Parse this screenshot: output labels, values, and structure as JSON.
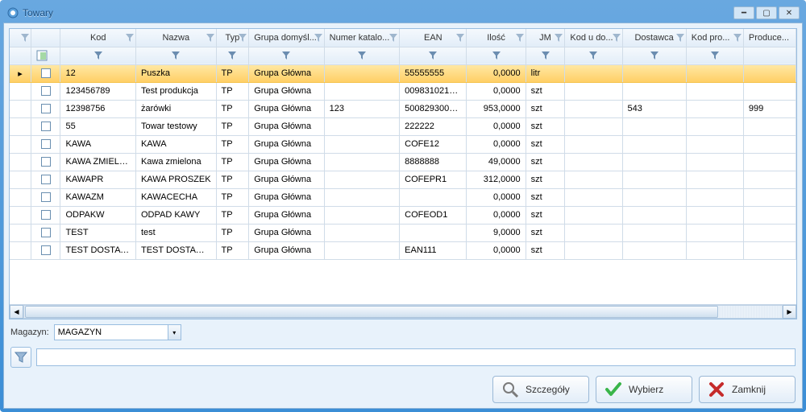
{
  "window": {
    "title": "Towary"
  },
  "columns": {
    "kod": "Kod",
    "nazwa": "Nazwa",
    "typ": "Typ",
    "grupa": "Grupa domyśl...",
    "nkat": "Numer katalo...",
    "ean": "EAN",
    "ilosc": "Ilość",
    "jm": "JM",
    "kodd": "Kod u do...",
    "dost": "Dostawca",
    "kodp": "Kod pro...",
    "prod": "Produce..."
  },
  "rows": [
    {
      "kod": "12",
      "nazwa": "Puszka",
      "typ": "TP",
      "grupa": "Grupa Główna",
      "nkat": "",
      "ean": "55555555",
      "ilosc": "0,0000",
      "jm": "litr",
      "kodd": "",
      "dost": "",
      "kodp": "",
      "prod": ""
    },
    {
      "kod": "123456789",
      "nazwa": "Test produkcja",
      "typ": "TP",
      "grupa": "Grupa Główna",
      "nkat": "",
      "ean": "0098310213...",
      "ilosc": "0,0000",
      "jm": "szt",
      "kodd": "",
      "dost": "",
      "kodp": "",
      "prod": ""
    },
    {
      "kod": "12398756",
      "nazwa": "żarówki",
      "typ": "TP",
      "grupa": "Grupa Główna",
      "nkat": "123",
      "ean": "5008293001...",
      "ilosc": "953,0000",
      "jm": "szt",
      "kodd": "",
      "dost": "543",
      "kodp": "",
      "prod": "999"
    },
    {
      "kod": "55",
      "nazwa": "Towar testowy",
      "typ": "TP",
      "grupa": "Grupa Główna",
      "nkat": "",
      "ean": "222222",
      "ilosc": "0,0000",
      "jm": "szt",
      "kodd": "",
      "dost": "",
      "kodp": "",
      "prod": ""
    },
    {
      "kod": "KAWA",
      "nazwa": "KAWA",
      "typ": "TP",
      "grupa": "Grupa Główna",
      "nkat": "",
      "ean": "COFE12",
      "ilosc": "0,0000",
      "jm": "szt",
      "kodd": "",
      "dost": "",
      "kodp": "",
      "prod": ""
    },
    {
      "kod": "KAWA  ZMIELO...",
      "nazwa": "Kawa zmielona",
      "typ": "TP",
      "grupa": "Grupa Główna",
      "nkat": "",
      "ean": "8888888",
      "ilosc": "49,0000",
      "jm": "szt",
      "kodd": "",
      "dost": "",
      "kodp": "",
      "prod": ""
    },
    {
      "kod": "KAWAPR",
      "nazwa": "KAWA PROSZEK",
      "typ": "TP",
      "grupa": "Grupa Główna",
      "nkat": "",
      "ean": "COFEPR1",
      "ilosc": "312,0000",
      "jm": "szt",
      "kodd": "",
      "dost": "",
      "kodp": "",
      "prod": ""
    },
    {
      "kod": "KAWAZM",
      "nazwa": "KAWACECHA",
      "typ": "TP",
      "grupa": "Grupa Główna",
      "nkat": "",
      "ean": "",
      "ilosc": "0,0000",
      "jm": "szt",
      "kodd": "",
      "dost": "",
      "kodp": "",
      "prod": ""
    },
    {
      "kod": "ODPAKW",
      "nazwa": "ODPAD KAWY",
      "typ": "TP",
      "grupa": "Grupa Główna",
      "nkat": "",
      "ean": "COFEOD1",
      "ilosc": "0,0000",
      "jm": "szt",
      "kodd": "",
      "dost": "",
      "kodp": "",
      "prod": ""
    },
    {
      "kod": "TEST",
      "nazwa": "test",
      "typ": "TP",
      "grupa": "Grupa Główna",
      "nkat": "",
      "ean": "",
      "ilosc": "9,0000",
      "jm": "szt",
      "kodd": "",
      "dost": "",
      "kodp": "",
      "prod": ""
    },
    {
      "kod": "TEST DOSTAWCY",
      "nazwa": "TEST DOSTAWC...",
      "typ": "TP",
      "grupa": "Grupa Główna",
      "nkat": "",
      "ean": "EAN111",
      "ilosc": "0,0000",
      "jm": "szt",
      "kodd": "",
      "dost": "",
      "kodp": "",
      "prod": ""
    }
  ],
  "magazyn": {
    "label": "Magazyn:",
    "value": "MAGAZYN"
  },
  "buttons": {
    "details": "Szczegóły",
    "select": "Wybierz",
    "close": "Zamknij"
  }
}
